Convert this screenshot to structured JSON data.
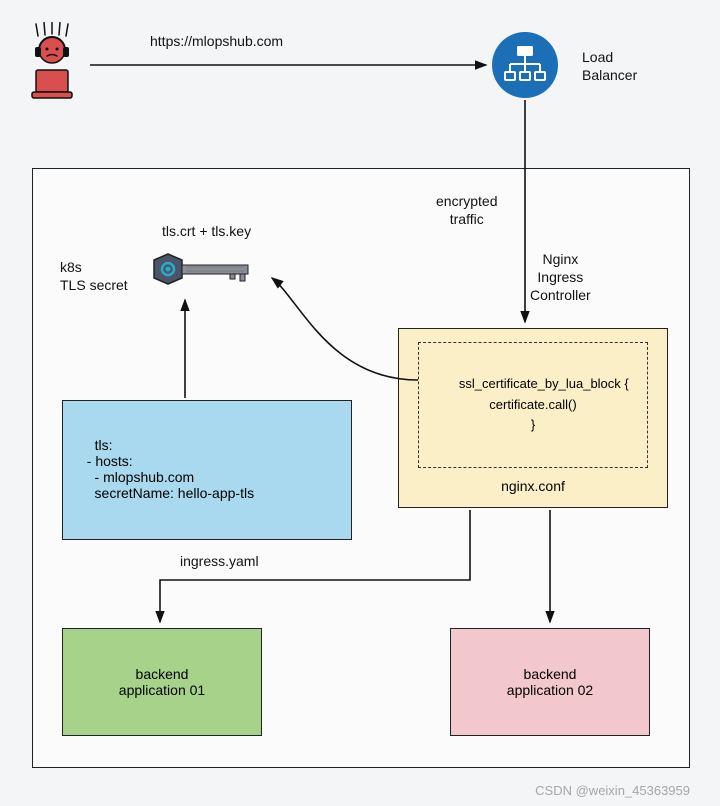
{
  "url_label": "https://mlopshub.com",
  "load_balancer_label": "Load\nBalancer",
  "encrypted_traffic_label": "encrypted\ntraffic",
  "tls_files_label": "tls.crt + tls.key",
  "k8s_secret_label": "k8s\nTLS secret",
  "ingress_controller_label": "Nginx\nIngress\nController",
  "ingress_yaml_content": "tls:\n  - hosts:\n    - mlopshub.com\n    secretName: hello-app-tls",
  "ingress_yaml_label": "ingress.yaml",
  "lua_block_content": "ssl_certificate_by_lua_block {\ncertificate.call()\n}",
  "nginx_conf_label": "nginx.conf",
  "backend1_label": "backend\napplication 01",
  "backend2_label": "backend\napplication 02",
  "watermark": "CSDN @weixin_45363959"
}
